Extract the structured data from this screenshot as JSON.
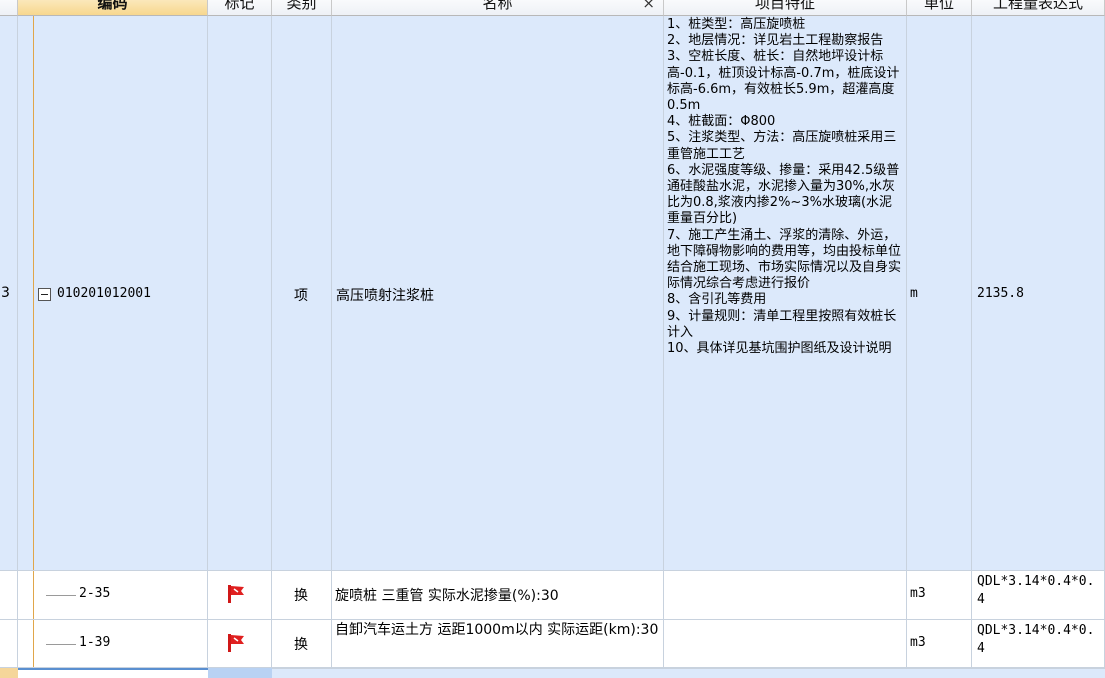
{
  "columns": {
    "code": "编码",
    "mark": "标记",
    "category": "类别",
    "name": "名称",
    "name_clear": "×",
    "features": "项目特征",
    "unit": "单位",
    "quantity_expr": "工程量表达式"
  },
  "rows": [
    {
      "index": "3",
      "code": "010201012001",
      "category": "项",
      "name": "高压喷射注浆桩",
      "features": "1、桩类型：高压旋喷桩\n2、地层情况：详见岩土工程勘察报告\n3、空桩长度、桩长：自然地坪设计标高-0.1，桩顶设计标高-0.7m，桩底设计标高-6.6m，有效桩长5.9m，超灌高度0.5m\n4、桩截面：Φ800\n5、注浆类型、方法：高压旋喷桩采用三重管施工工艺\n6、水泥强度等级、掺量：采用42.5级普通硅酸盐水泥，水泥掺入量为30%,水灰比为0.8,浆液内掺2%~3%水玻璃(水泥重量百分比)\n7、施工产生涌土、浮浆的清除、外运，地下障碍物影响的费用等，均由投标单位结合施工现场、市场实际情况以及自身实际情况综合考虑进行报价\n8、含引孔等费用\n9、计量规则：清单工程里按照有效桩长计入\n10、具体详见基坑围护图纸及设计说明",
      "unit": "m",
      "quantity_expr": "2135.8"
    },
    {
      "code": "2-35",
      "category": "换",
      "name": "旋喷桩 三重管  实际水泥掺量(%):30",
      "unit": "m3",
      "quantity_expr": "QDL*3.14*0.4*0.4",
      "mark_icon": "red-flag-icon"
    },
    {
      "code": "1-39",
      "category": "换",
      "name": "自卸汽车运土方 运距1000m以内  实际运距(km):30",
      "unit": "m3",
      "quantity_expr": "QDL*3.14*0.4*0.4",
      "mark_icon": "red-flag-icon"
    }
  ],
  "colors": {
    "selected_row": "#dce9fb",
    "header_selected": "#f7d78e",
    "flag_red": "#e02020",
    "tree_line": "#e0a64a"
  }
}
